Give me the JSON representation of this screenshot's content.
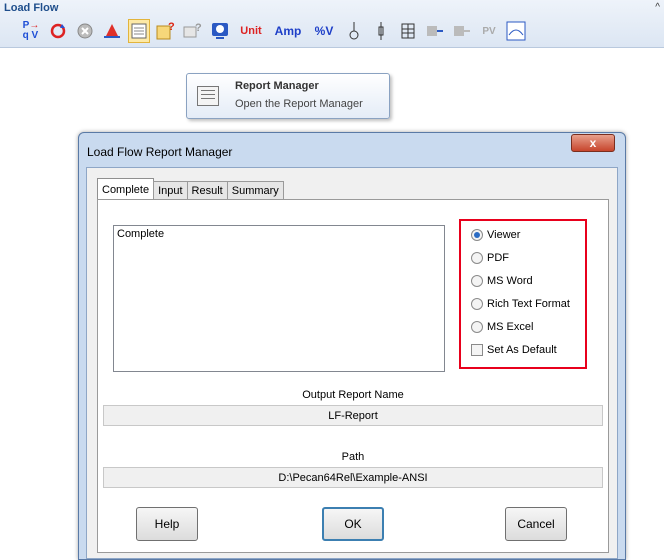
{
  "toolbar": {
    "title": "Load Flow",
    "corner": "^",
    "icons": [
      {
        "name": "pq-v-icon",
        "glyph": "P→V"
      },
      {
        "name": "refresh-icon",
        "glyph": "⟳"
      },
      {
        "name": "stop-icon",
        "glyph": "⊗"
      },
      {
        "name": "alarm-icon",
        "glyph": "▲"
      },
      {
        "name": "report-manager-icon",
        "glyph": "▤"
      },
      {
        "name": "report-help-icon",
        "glyph": "?"
      },
      {
        "name": "report-query-icon",
        "glyph": "?"
      },
      {
        "name": "display-icon",
        "glyph": "◉"
      },
      {
        "name": "unit-icon",
        "glyph": "Unit"
      },
      {
        "name": "amp-icon",
        "glyph": "Amp"
      },
      {
        "name": "percent-v-icon",
        "glyph": "%V"
      },
      {
        "name": "probe-icon",
        "glyph": "♁"
      },
      {
        "name": "bus-icon",
        "glyph": "▯"
      },
      {
        "name": "grid-icon",
        "glyph": "▦"
      },
      {
        "name": "load-icon",
        "glyph": "⊃"
      },
      {
        "name": "gen-icon",
        "glyph": "⊃"
      },
      {
        "name": "pq-icon",
        "glyph": "PV"
      },
      {
        "name": "meter-icon",
        "glyph": "▣"
      }
    ]
  },
  "tooltip": {
    "title": "Report Manager",
    "description": "Open the Report Manager"
  },
  "dialog": {
    "title": "Load Flow Report Manager",
    "close_label": "x",
    "tabs": [
      "Complete",
      "Input",
      "Result",
      "Summary"
    ],
    "active_tab": "Complete",
    "list_items": [
      "Complete"
    ],
    "output_options": [
      "Viewer",
      "PDF",
      "MS Word",
      "Rich Text Format",
      "MS Excel"
    ],
    "selected_output": "Viewer",
    "set_default_label": "Set As Default",
    "set_default_checked": false,
    "output_report_name_label": "Output Report Name",
    "output_report_name": "LF-Report",
    "path_label": "Path",
    "path": "D:\\Pecan64Rel\\Example-ANSI",
    "help_label": "Help",
    "ok_label": "OK",
    "cancel_label": "Cancel"
  }
}
